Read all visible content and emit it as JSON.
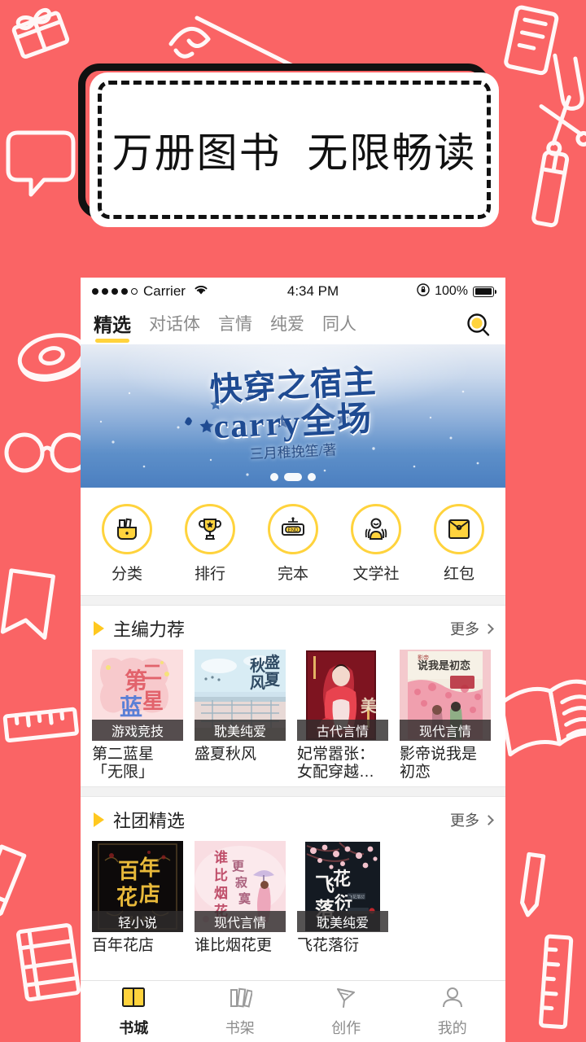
{
  "theme": {
    "background": "#fa6465",
    "accent_yellow": "#ffd33d",
    "badge_bg": "#302d2d"
  },
  "headline": {
    "text": "万册图书  无限畅读"
  },
  "status_bar": {
    "carrier": "Carrier",
    "time": "4:34 PM",
    "battery_percent": "100%",
    "wifi_icon": "wifi-icon",
    "lock_icon": "rotation-lock-icon",
    "battery_icon": "battery-full-icon"
  },
  "tabs": {
    "items": [
      {
        "label": "精选",
        "active": true
      },
      {
        "label": "对话体",
        "active": false
      },
      {
        "label": "言情",
        "active": false
      },
      {
        "label": "纯爱",
        "active": false
      },
      {
        "label": "同人",
        "active": false
      }
    ],
    "search_icon": "search-icon"
  },
  "banner": {
    "title": "快穿之宿主",
    "subtitle": "carry全场",
    "author": "三月稚挽笙/著",
    "dots_total": 3,
    "dots_active_index": 1
  },
  "quick_actions": [
    {
      "label": "分类",
      "icon": "category-bag-icon"
    },
    {
      "label": "排行",
      "icon": "trophy-icon"
    },
    {
      "label": "完本",
      "icon": "end-sign-icon"
    },
    {
      "label": "文学社",
      "icon": "people-group-icon"
    },
    {
      "label": "红包",
      "icon": "red-envelope-icon"
    }
  ],
  "sections": [
    {
      "title": "主编力荐",
      "more_label": "更多",
      "books": [
        {
          "title": "第二蓝星「无限」",
          "badge": "游戏竞技",
          "cover_style": "pink"
        },
        {
          "title": "盛夏秋风",
          "badge": "耽美纯爱",
          "cover_style": "blue"
        },
        {
          "title": "妃常嚣张：女配穿越…",
          "badge": "古代言情",
          "cover_style": "red"
        },
        {
          "title": "影帝说我是初恋",
          "badge": "现代言情",
          "cover_style": "cream"
        }
      ]
    },
    {
      "title": "社团精选",
      "more_label": "更多",
      "books": [
        {
          "title": "百年花店",
          "badge": "轻小说",
          "cover_style": "black"
        },
        {
          "title": "谁比烟花更",
          "badge": "现代言情",
          "cover_style": "lightpink"
        },
        {
          "title": "飞花落衍",
          "badge": "耽美纯爱",
          "cover_style": "darkblossom"
        }
      ]
    }
  ],
  "bottom_nav": [
    {
      "label": "书城",
      "icon": "book-city-icon",
      "active": true
    },
    {
      "label": "书架",
      "icon": "bookshelf-icon",
      "active": false
    },
    {
      "label": "创作",
      "icon": "pen-create-icon",
      "active": false
    },
    {
      "label": "我的",
      "icon": "profile-person-icon",
      "active": false
    }
  ]
}
